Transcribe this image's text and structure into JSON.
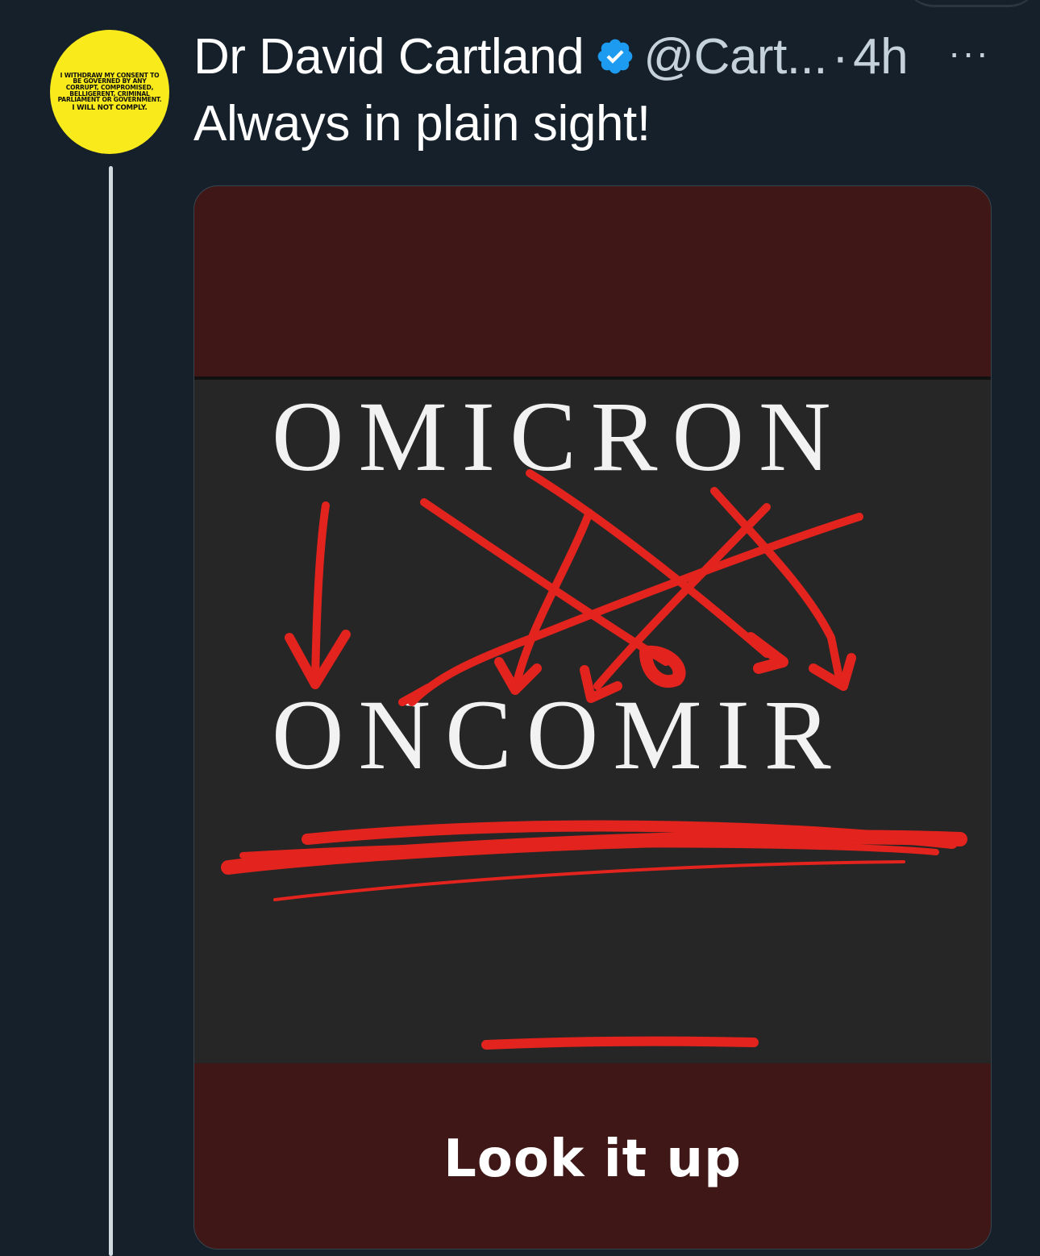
{
  "user": {
    "name": "Dr David Cartland",
    "handle": "@Cart...",
    "separator": "·",
    "time": "4h",
    "verified": true,
    "avatar_text_main": "I WITHDRAW MY CONSENT TO BE GOVERNED BY ANY CORRUPT, COMPROMISED, BELLIGERENT, CRIMINAL PARLIAMENT OR GOVERNMENT.",
    "avatar_text_tail": "I WILL NOT COMPLY."
  },
  "tweet": {
    "text": "Always in plain sight!"
  },
  "menu": {
    "more_label": "···"
  },
  "media": {
    "word_top": "OMICRON",
    "word_bottom": "ONCOMIR",
    "caption": "Look it up"
  },
  "colors": {
    "background": "#15202b",
    "verified_blue": "#1d9bf0",
    "avatar_yellow": "#f8ea1b",
    "media_maroon": "#3e1716",
    "scribble_red": "#e3231d"
  }
}
